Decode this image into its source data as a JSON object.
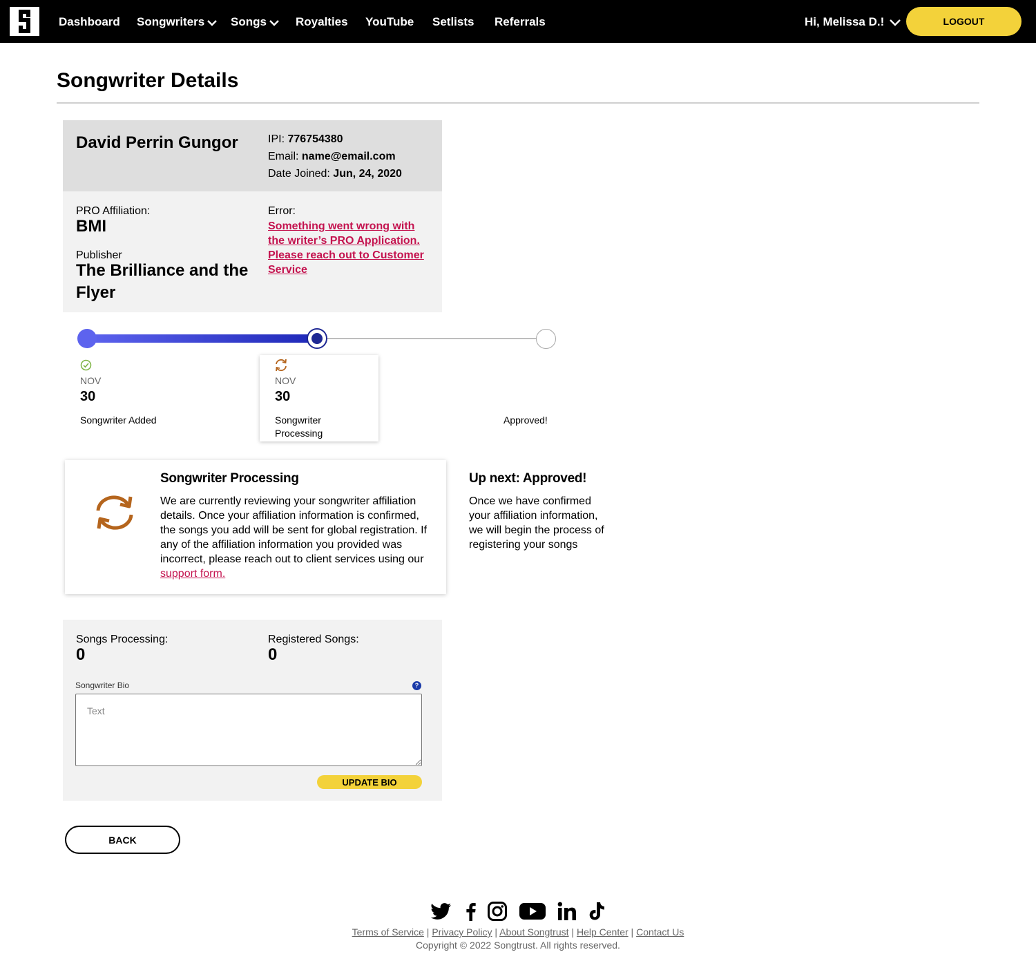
{
  "nav": {
    "items": [
      "Dashboard",
      "Songwriters",
      "Songs",
      "Royalties",
      "YouTube",
      "Setlists",
      "Referrals"
    ],
    "greeting": "Hi, Melissa D.!",
    "logout": "LOGOUT"
  },
  "page": {
    "title": "Songwriter Details"
  },
  "writer": {
    "name": "David Perrin Gungor",
    "ipi_label": "IPI:",
    "ipi": "776754380",
    "email_label": "Email:",
    "email": "name@email.com",
    "joined_label": "Date Joined:",
    "joined": "Jun, 24, 2020",
    "pro_label": "PRO Affiliation:",
    "pro": "BMI",
    "publisher_label": "Publisher",
    "publisher": "The Brilliance and the Flyer",
    "error_label": "Error:",
    "error_text": "Something went wrong with the writer’s PRO Application. Please reach out to Customer Service"
  },
  "progress": {
    "fraction": 0.5,
    "steps": [
      {
        "month": "NOV",
        "day": "30",
        "label": "Songwriter Added",
        "status": "done"
      },
      {
        "month": "NOV",
        "day": "30",
        "label": "Songwriter Processing",
        "status": "current"
      },
      {
        "label": "Approved!",
        "status": "pending"
      }
    ]
  },
  "info": {
    "title": "Songwriter Processing",
    "text": "We are currently reviewing your songwriter affiliation details. Once your affiliation information is confirmed, the songs you add will be sent for global registration. If any of the affiliation information you provided was incorrect, please reach out to client services using our ",
    "link": "support form.",
    "next_title": "Up next: Approved!",
    "next_text": "Once we have confirmed your affiliation information, we will begin the process of registering your songs"
  },
  "songs": {
    "processing_label": "Songs Processing:",
    "processing": "0",
    "registered_label": "Registered Songs:",
    "registered": "0",
    "bio_label": "Songwriter Bio",
    "bio_placeholder": "Text",
    "update_label": "UPDATE BIO"
  },
  "back_label": "BACK",
  "footer": {
    "links": [
      "Terms of Service",
      "Privacy Policy",
      "About Songtrust",
      "Help Center",
      "Contact Us"
    ],
    "copyright": "Copyright © 2022 Songtrust. All rights reserved."
  },
  "colors": {
    "accent": "#f3d23a",
    "link": "#c4134f",
    "progress": "#1e28b8",
    "processing_icon": "#b5651d",
    "check": "#7cb342"
  }
}
